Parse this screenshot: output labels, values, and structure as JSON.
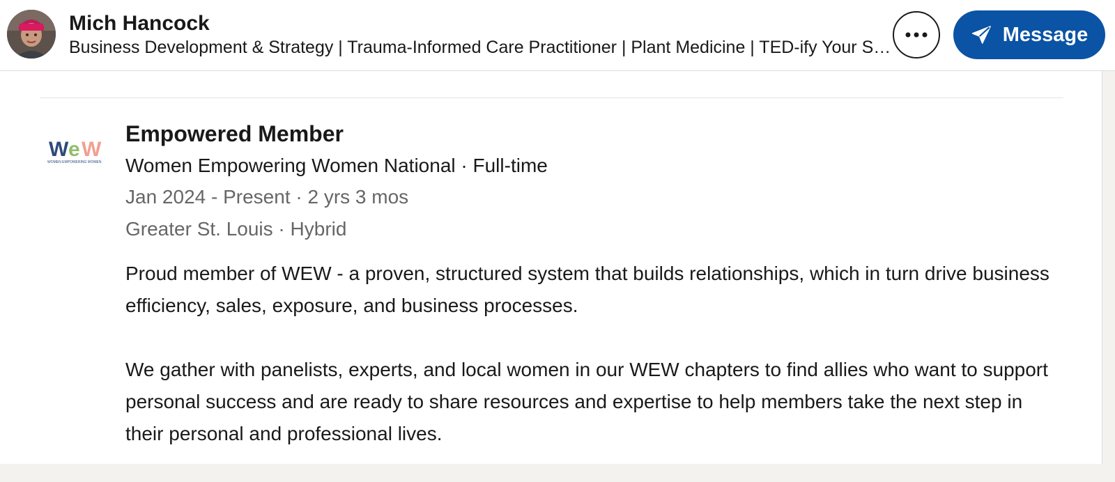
{
  "header": {
    "name": "Mich Hancock",
    "headline": "Business Development & Strategy | Trauma-Informed Care Practitioner | Plant Medicine | TED-ify Your Story",
    "more_icon": "ellipsis-icon",
    "message_label": "Message",
    "message_icon": "send-icon",
    "accent_color": "#0a53a5"
  },
  "experience": {
    "logo_text": "WEW",
    "logo_subtext": "WOMEN EMPOWERING WOMEN",
    "title": "Empowered Member",
    "company_line": "Women Empowering Women National · Full-time",
    "dates": "Jan 2024 - Present · 2 yrs 3 mos",
    "location": "Greater St. Louis · Hybrid",
    "description_1": "Proud member of WEW - a proven, structured system that builds relationships, which in turn drive business efficiency, sales, exposure, and business processes.",
    "description_2": "We gather with panelists, experts, and local women in our WEW chapters to find allies who want to support personal success and are ready to share resources and expertise to help members take the next step in their personal and professional lives."
  }
}
